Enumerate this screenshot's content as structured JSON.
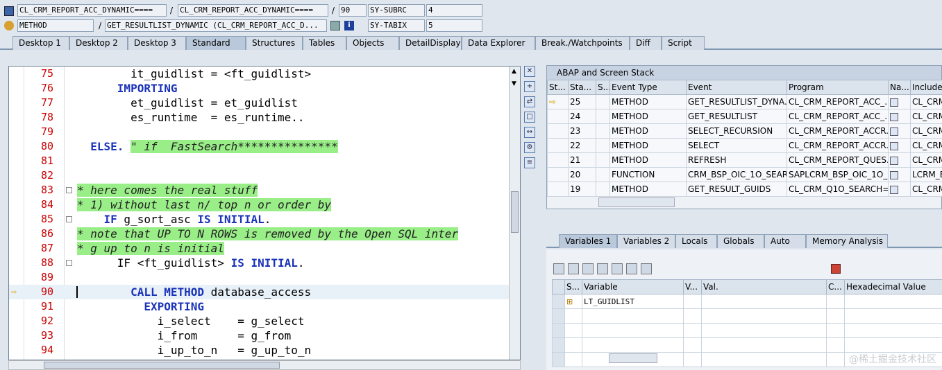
{
  "info": {
    "row1": {
      "program1": "CL_CRM_REPORT_ACC_DYNAMIC====",
      "program2": "CL_CRM_REPORT_ACC_DYNAMIC====",
      "line": "90",
      "sysvar": "SY-SUBRC",
      "sysval": "4"
    },
    "row2": {
      "event_type": "METHOD",
      "event": "GET_RESULTLIST_DYNAMIC (CL_CRM_REPORT_ACC_D...",
      "sysvar": "SY-TABIX",
      "sysval": "5"
    },
    "slash": "/"
  },
  "tabs": [
    "Desktop 1",
    "Desktop 2",
    "Desktop 3",
    "Standard",
    "Structures",
    "Tables",
    "Objects",
    "DetailDisplay",
    "Data Explorer",
    "Break./Watchpoints",
    "Diff",
    "Script"
  ],
  "code": [
    {
      "n": "75",
      "t": [
        {
          "c": "",
          "v": "        it_guidlist = <ft_guidlist>"
        }
      ]
    },
    {
      "n": "76",
      "t": [
        {
          "c": "",
          "v": "      "
        },
        {
          "c": "kw",
          "v": "IMPORTING"
        }
      ]
    },
    {
      "n": "77",
      "t": [
        {
          "c": "",
          "v": "        et_guidlist = et_guidlist"
        }
      ]
    },
    {
      "n": "78",
      "t": [
        {
          "c": "",
          "v": "        es_runtime  = es_runtime.."
        }
      ]
    },
    {
      "n": "79",
      "t": [
        {
          "c": "",
          "v": ""
        }
      ]
    },
    {
      "n": "80",
      "t": [
        {
          "c": "",
          "v": "  "
        },
        {
          "c": "kw",
          "v": "ELSE."
        },
        {
          "c": "",
          "v": " "
        },
        {
          "c": "cm",
          "v": "\" if  FastSearch***************"
        }
      ]
    },
    {
      "n": "81",
      "t": [
        {
          "c": "",
          "v": ""
        }
      ]
    },
    {
      "n": "82",
      "t": [
        {
          "c": "",
          "v": ""
        }
      ]
    },
    {
      "n": "83",
      "t": [
        {
          "c": "cm",
          "v": "* here comes the real stuff"
        }
      ]
    },
    {
      "n": "84",
      "t": [
        {
          "c": "cm",
          "v": "* 1) without last n/ top n or order by"
        }
      ]
    },
    {
      "n": "85",
      "t": [
        {
          "c": "",
          "v": "    "
        },
        {
          "c": "kw",
          "v": "IF"
        },
        {
          "c": "",
          "v": " g_sort_asc "
        },
        {
          "c": "kw",
          "v": "IS INITIAL"
        },
        {
          "c": "",
          "v": "."
        }
      ]
    },
    {
      "n": "86",
      "t": [
        {
          "c": "cm",
          "v": "* note that UP TO N ROWS is removed by the Open SQL inter"
        }
      ]
    },
    {
      "n": "87",
      "t": [
        {
          "c": "cm",
          "v": "* g up to n is initial"
        }
      ]
    },
    {
      "n": "88",
      "t": [
        {
          "c": "",
          "v": "      IF <ft_guidlist> "
        },
        {
          "c": "kw",
          "v": "IS INITIAL"
        },
        {
          "c": "",
          "v": "."
        }
      ]
    },
    {
      "n": "89",
      "t": [
        {
          "c": "",
          "v": ""
        }
      ]
    },
    {
      "n": "90",
      "t": [
        {
          "c": "",
          "v": "        "
        },
        {
          "c": "kw",
          "v": "CALL METHOD"
        },
        {
          "c": "",
          "v": " database_access"
        }
      ]
    },
    {
      "n": "91",
      "t": [
        {
          "c": "",
          "v": "          "
        },
        {
          "c": "kw",
          "v": "EXPORTING"
        }
      ]
    },
    {
      "n": "92",
      "t": [
        {
          "c": "",
          "v": "            i_select    = g_select"
        }
      ]
    },
    {
      "n": "93",
      "t": [
        {
          "c": "",
          "v": "            i_from      = g_from"
        }
      ]
    },
    {
      "n": "94",
      "t": [
        {
          "c": "",
          "v": "            i_up_to_n   = g_up_to_n"
        }
      ]
    }
  ],
  "stack": {
    "title": "ABAP and Screen Stack",
    "headers": [
      "St...",
      "Sta...",
      "S...",
      "Event Type",
      "Event",
      "Program",
      "Na...",
      "Include"
    ],
    "rows": [
      {
        "level": "25",
        "type": "METHOD",
        "event": "GET_RESULTLIST_DYNA...",
        "program": "CL_CRM_REPORT_ACC_...",
        "include": "CL_CRM"
      },
      {
        "level": "24",
        "type": "METHOD",
        "event": "GET_RESULTLIST",
        "program": "CL_CRM_REPORT_ACC_...",
        "include": "CL_CRM"
      },
      {
        "level": "23",
        "type": "METHOD",
        "event": "SELECT_RECURSION",
        "program": "CL_CRM_REPORT_ACCR...",
        "include": "CL_CRM"
      },
      {
        "level": "22",
        "type": "METHOD",
        "event": "SELECT",
        "program": "CL_CRM_REPORT_ACCR...",
        "include": "CL_CRM"
      },
      {
        "level": "21",
        "type": "METHOD",
        "event": "REFRESH",
        "program": "CL_CRM_REPORT_QUES...",
        "include": "CL_CRM"
      },
      {
        "level": "20",
        "type": "FUNCTION",
        "event": "CRM_BSP_OIC_1O_SEAR...",
        "program": "SAPLCRM_BSP_OIC_1O_...",
        "include": "LCRM_BS"
      },
      {
        "level": "19",
        "type": "METHOD",
        "event": "GET_RESULT_GUIDS",
        "program": "CL_CRM_Q1O_SEARCH=...",
        "include": "CL_CRM"
      }
    ]
  },
  "var_tabs": [
    "Variables 1",
    "Variables 2",
    "Locals",
    "Globals",
    "Auto",
    "Memory Analysis"
  ],
  "vars": {
    "headers": [
      "S...",
      "Variable",
      "V...",
      "Val.",
      "C...",
      "Hexadecimal Value"
    ],
    "rows": [
      {
        "name": "LT_GUIDLIST"
      }
    ]
  },
  "watermark": "@稀土掘金技术社区"
}
